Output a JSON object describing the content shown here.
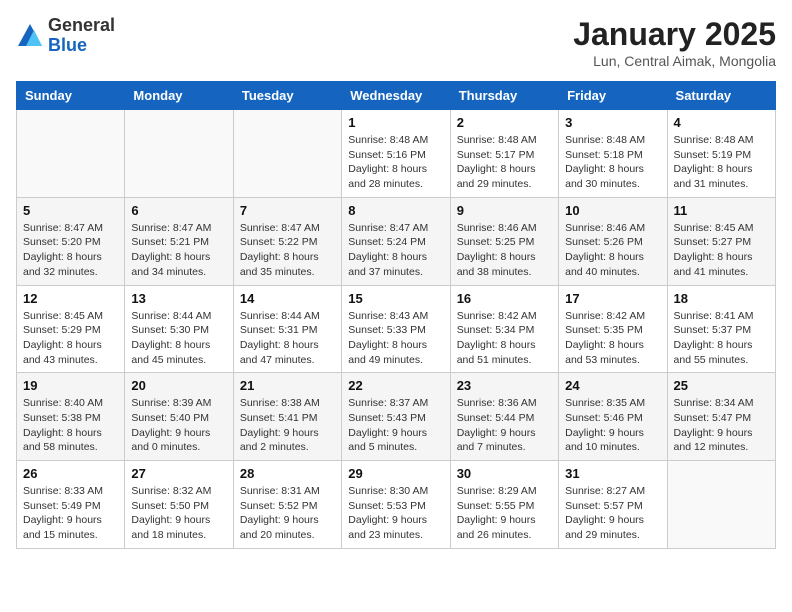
{
  "header": {
    "logo_line1": "General",
    "logo_line2": "Blue",
    "month_year": "January 2025",
    "location": "Lun, Central Aimak, Mongolia"
  },
  "days_of_week": [
    "Sunday",
    "Monday",
    "Tuesday",
    "Wednesday",
    "Thursday",
    "Friday",
    "Saturday"
  ],
  "weeks": [
    [
      {
        "day": "",
        "sunrise": "",
        "sunset": "",
        "daylight": ""
      },
      {
        "day": "",
        "sunrise": "",
        "sunset": "",
        "daylight": ""
      },
      {
        "day": "",
        "sunrise": "",
        "sunset": "",
        "daylight": ""
      },
      {
        "day": "1",
        "sunrise": "Sunrise: 8:48 AM",
        "sunset": "Sunset: 5:16 PM",
        "daylight": "Daylight: 8 hours and 28 minutes."
      },
      {
        "day": "2",
        "sunrise": "Sunrise: 8:48 AM",
        "sunset": "Sunset: 5:17 PM",
        "daylight": "Daylight: 8 hours and 29 minutes."
      },
      {
        "day": "3",
        "sunrise": "Sunrise: 8:48 AM",
        "sunset": "Sunset: 5:18 PM",
        "daylight": "Daylight: 8 hours and 30 minutes."
      },
      {
        "day": "4",
        "sunrise": "Sunrise: 8:48 AM",
        "sunset": "Sunset: 5:19 PM",
        "daylight": "Daylight: 8 hours and 31 minutes."
      }
    ],
    [
      {
        "day": "5",
        "sunrise": "Sunrise: 8:47 AM",
        "sunset": "Sunset: 5:20 PM",
        "daylight": "Daylight: 8 hours and 32 minutes."
      },
      {
        "day": "6",
        "sunrise": "Sunrise: 8:47 AM",
        "sunset": "Sunset: 5:21 PM",
        "daylight": "Daylight: 8 hours and 34 minutes."
      },
      {
        "day": "7",
        "sunrise": "Sunrise: 8:47 AM",
        "sunset": "Sunset: 5:22 PM",
        "daylight": "Daylight: 8 hours and 35 minutes."
      },
      {
        "day": "8",
        "sunrise": "Sunrise: 8:47 AM",
        "sunset": "Sunset: 5:24 PM",
        "daylight": "Daylight: 8 hours and 37 minutes."
      },
      {
        "day": "9",
        "sunrise": "Sunrise: 8:46 AM",
        "sunset": "Sunset: 5:25 PM",
        "daylight": "Daylight: 8 hours and 38 minutes."
      },
      {
        "day": "10",
        "sunrise": "Sunrise: 8:46 AM",
        "sunset": "Sunset: 5:26 PM",
        "daylight": "Daylight: 8 hours and 40 minutes."
      },
      {
        "day": "11",
        "sunrise": "Sunrise: 8:45 AM",
        "sunset": "Sunset: 5:27 PM",
        "daylight": "Daylight: 8 hours and 41 minutes."
      }
    ],
    [
      {
        "day": "12",
        "sunrise": "Sunrise: 8:45 AM",
        "sunset": "Sunset: 5:29 PM",
        "daylight": "Daylight: 8 hours and 43 minutes."
      },
      {
        "day": "13",
        "sunrise": "Sunrise: 8:44 AM",
        "sunset": "Sunset: 5:30 PM",
        "daylight": "Daylight: 8 hours and 45 minutes."
      },
      {
        "day": "14",
        "sunrise": "Sunrise: 8:44 AM",
        "sunset": "Sunset: 5:31 PM",
        "daylight": "Daylight: 8 hours and 47 minutes."
      },
      {
        "day": "15",
        "sunrise": "Sunrise: 8:43 AM",
        "sunset": "Sunset: 5:33 PM",
        "daylight": "Daylight: 8 hours and 49 minutes."
      },
      {
        "day": "16",
        "sunrise": "Sunrise: 8:42 AM",
        "sunset": "Sunset: 5:34 PM",
        "daylight": "Daylight: 8 hours and 51 minutes."
      },
      {
        "day": "17",
        "sunrise": "Sunrise: 8:42 AM",
        "sunset": "Sunset: 5:35 PM",
        "daylight": "Daylight: 8 hours and 53 minutes."
      },
      {
        "day": "18",
        "sunrise": "Sunrise: 8:41 AM",
        "sunset": "Sunset: 5:37 PM",
        "daylight": "Daylight: 8 hours and 55 minutes."
      }
    ],
    [
      {
        "day": "19",
        "sunrise": "Sunrise: 8:40 AM",
        "sunset": "Sunset: 5:38 PM",
        "daylight": "Daylight: 8 hours and 58 minutes."
      },
      {
        "day": "20",
        "sunrise": "Sunrise: 8:39 AM",
        "sunset": "Sunset: 5:40 PM",
        "daylight": "Daylight: 9 hours and 0 minutes."
      },
      {
        "day": "21",
        "sunrise": "Sunrise: 8:38 AM",
        "sunset": "Sunset: 5:41 PM",
        "daylight": "Daylight: 9 hours and 2 minutes."
      },
      {
        "day": "22",
        "sunrise": "Sunrise: 8:37 AM",
        "sunset": "Sunset: 5:43 PM",
        "daylight": "Daylight: 9 hours and 5 minutes."
      },
      {
        "day": "23",
        "sunrise": "Sunrise: 8:36 AM",
        "sunset": "Sunset: 5:44 PM",
        "daylight": "Daylight: 9 hours and 7 minutes."
      },
      {
        "day": "24",
        "sunrise": "Sunrise: 8:35 AM",
        "sunset": "Sunset: 5:46 PM",
        "daylight": "Daylight: 9 hours and 10 minutes."
      },
      {
        "day": "25",
        "sunrise": "Sunrise: 8:34 AM",
        "sunset": "Sunset: 5:47 PM",
        "daylight": "Daylight: 9 hours and 12 minutes."
      }
    ],
    [
      {
        "day": "26",
        "sunrise": "Sunrise: 8:33 AM",
        "sunset": "Sunset: 5:49 PM",
        "daylight": "Daylight: 9 hours and 15 minutes."
      },
      {
        "day": "27",
        "sunrise": "Sunrise: 8:32 AM",
        "sunset": "Sunset: 5:50 PM",
        "daylight": "Daylight: 9 hours and 18 minutes."
      },
      {
        "day": "28",
        "sunrise": "Sunrise: 8:31 AM",
        "sunset": "Sunset: 5:52 PM",
        "daylight": "Daylight: 9 hours and 20 minutes."
      },
      {
        "day": "29",
        "sunrise": "Sunrise: 8:30 AM",
        "sunset": "Sunset: 5:53 PM",
        "daylight": "Daylight: 9 hours and 23 minutes."
      },
      {
        "day": "30",
        "sunrise": "Sunrise: 8:29 AM",
        "sunset": "Sunset: 5:55 PM",
        "daylight": "Daylight: 9 hours and 26 minutes."
      },
      {
        "day": "31",
        "sunrise": "Sunrise: 8:27 AM",
        "sunset": "Sunset: 5:57 PM",
        "daylight": "Daylight: 9 hours and 29 minutes."
      },
      {
        "day": "",
        "sunrise": "",
        "sunset": "",
        "daylight": ""
      }
    ]
  ]
}
